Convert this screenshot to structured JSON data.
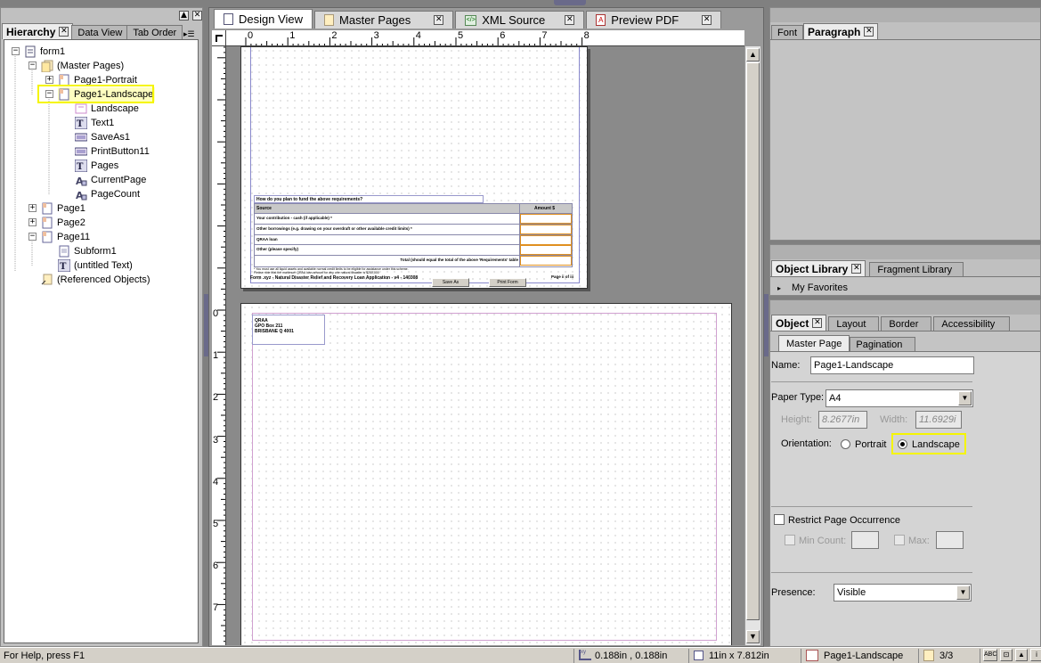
{
  "hierarchy_panel": {
    "tabs": [
      {
        "label": "Hierarchy",
        "active": true
      },
      {
        "label": "Data View",
        "active": false
      },
      {
        "label": "Tab Order",
        "active": false
      }
    ],
    "tree": [
      {
        "label": "form1",
        "icon": "form-icon",
        "depth": 0,
        "expander": "-"
      },
      {
        "label": "(Master Pages)",
        "icon": "master-pages-icon",
        "depth": 1,
        "expander": "-"
      },
      {
        "label": "Page1-Portrait",
        "icon": "page-icon",
        "depth": 2,
        "expander": "+"
      },
      {
        "label": "Page1-Landscape",
        "icon": "page-icon",
        "depth": 2,
        "expander": "-",
        "selected": true
      },
      {
        "label": "Landscape",
        "icon": "content-area-icon",
        "depth": 3
      },
      {
        "label": "Text1",
        "icon": "text-icon",
        "depth": 3
      },
      {
        "label": "SaveAs1",
        "icon": "button-icon",
        "depth": 3
      },
      {
        "label": "PrintButton11",
        "icon": "button-icon",
        "depth": 3
      },
      {
        "label": "Pages",
        "icon": "text-icon",
        "depth": 3
      },
      {
        "label": "CurrentPage",
        "icon": "numeric-icon",
        "depth": 3
      },
      {
        "label": "PageCount",
        "icon": "numeric-icon",
        "depth": 3
      },
      {
        "label": "Page1",
        "icon": "page-icon",
        "depth": 1,
        "expander": "+"
      },
      {
        "label": "Page2",
        "icon": "page-icon",
        "depth": 1,
        "expander": "+"
      },
      {
        "label": "Page11",
        "icon": "page-icon",
        "depth": 1,
        "expander": "-"
      },
      {
        "label": "Subform1",
        "icon": "subform-icon",
        "depth": 2
      },
      {
        "label": "(untitled Text)",
        "icon": "text-icon",
        "depth": 2
      },
      {
        "label": "(Referenced Objects)",
        "icon": "referenced-objects-icon",
        "depth": 1
      }
    ]
  },
  "editor": {
    "tabs": [
      {
        "label": "Design View",
        "active": true,
        "icon": "page-icon"
      },
      {
        "label": "Master Pages",
        "active": false,
        "icon": "page-icon"
      },
      {
        "label": "XML Source",
        "active": false,
        "icon": "xml-icon"
      },
      {
        "label": "Preview PDF",
        "active": false,
        "icon": "pdf-icon"
      }
    ],
    "ruler_h": [
      "0",
      "1",
      "2",
      "3",
      "4",
      "5",
      "6",
      "7",
      "8"
    ],
    "ruler_v": [
      "0",
      "1",
      "2",
      "3",
      "4",
      "5",
      "6",
      "7",
      "8"
    ],
    "page1": {
      "question": "How do you plan to fund the above requirements?",
      "col_source": "Source",
      "col_amount": "Amount $",
      "rows": [
        "Your contribution - cash (if applicable) *",
        "Other borrowings (e.g. drawing on your overdraft or other available credit limits) *",
        "QRAA loan",
        "Other (please specify)"
      ],
      "total": "Total (should equal the total of the above 'Requirements' table",
      "note1": "* You must use all liquid assets and available normal credit limits to be eligible for assistance under this scheme.",
      "note2": "Please note that the maximum QRAA loan amount for any one natural disaster is $250,000",
      "footer": "Form .xyz - Natural Disaster Relief and Recovery Loan Application - v4 - 140308",
      "save_button": "Save As",
      "print_button": "Print Form",
      "page_of": "Page ii of iii"
    },
    "page2": {
      "address": [
        "QRAA",
        "GPO Box 211",
        "BRISBANE  Q  4001"
      ]
    }
  },
  "right_panels": {
    "font_tabs": [
      {
        "label": "Font",
        "active": false
      },
      {
        "label": "Paragraph",
        "active": true
      }
    ],
    "library_tabs": [
      {
        "label": "Object Library",
        "active": true
      },
      {
        "label": "Fragment Library",
        "active": false
      }
    ],
    "library_item": "My Favorites",
    "object_tabs": [
      {
        "label": "Object",
        "active": true
      },
      {
        "label": "Layout",
        "active": false
      },
      {
        "label": "Border",
        "active": false
      },
      {
        "label": "Accessibility",
        "active": false
      }
    ],
    "sub_tabs": [
      {
        "label": "Master Page",
        "active": true
      },
      {
        "label": "Pagination",
        "active": false
      }
    ],
    "name_label": "Name:",
    "name_value": "Page1-Landscape",
    "paper_type_label": "Paper Type:",
    "paper_type_value": "A4",
    "height_label": "Height:",
    "height_value": "8.2677in",
    "width_label": "Width:",
    "width_value": "11.6929i",
    "orientation_label": "Orientation:",
    "portrait_label": "Portrait",
    "landscape_label": "Landscape",
    "orientation_selected": "Landscape",
    "restrict_label": "Restrict Page Occurrence",
    "min_count_label": "Min Count:",
    "max_label": "Max:",
    "presence_label": "Presence:",
    "presence_value": "Visible"
  },
  "status_bar": {
    "help": "For Help, press F1",
    "coords": "0.188in , 0.188in",
    "size": "11in x 7.812in",
    "page": "Page1-Landscape",
    "page_count": "3/3"
  },
  "colors": {
    "highlight": "#f5f500",
    "panel_header": "#a9a9a9",
    "selected_item": "#ffffc0"
  }
}
